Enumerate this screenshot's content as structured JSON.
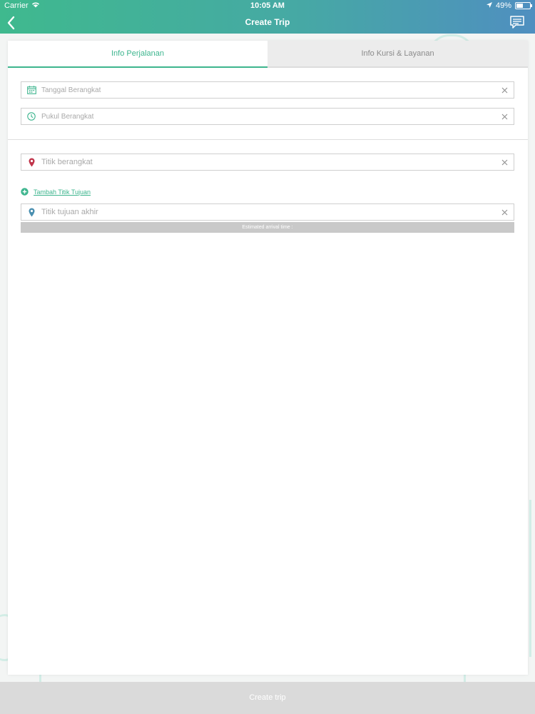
{
  "status_bar": {
    "carrier": "Carrier",
    "time": "10:05 AM",
    "battery_percent": "49%",
    "battery_level": 0.49
  },
  "nav": {
    "title": "Create Trip",
    "back_icon": "chevron-left-icon",
    "chat_icon": "chat-bubble-icon"
  },
  "tabs": [
    {
      "label": "Info Perjalanan",
      "active": true
    },
    {
      "label": "Info Kursi & Layanan",
      "active": false
    }
  ],
  "form": {
    "departure_date": {
      "placeholder": "Tanggal Berangkat",
      "value": "",
      "icon": "calendar-icon"
    },
    "departure_time": {
      "placeholder": "Pukul Berangkat",
      "value": "",
      "icon": "clock-icon"
    },
    "origin": {
      "placeholder": "Titik berangkat",
      "value": "",
      "icon": "map-pin-red-icon"
    },
    "add_destination_label": "Tambah Titik Tujuan",
    "destination": {
      "placeholder": "Titik tujuan akhir",
      "value": "",
      "icon": "map-pin-teal-icon"
    },
    "eta_label": "Estimated arrival time :"
  },
  "actions": {
    "create_trip_label": "Create trip"
  },
  "colors": {
    "accent": "#3db58e",
    "origin_pin": "#c0354b",
    "destination_pin": "#4a8fb0",
    "disabled_button": "#dadada"
  }
}
